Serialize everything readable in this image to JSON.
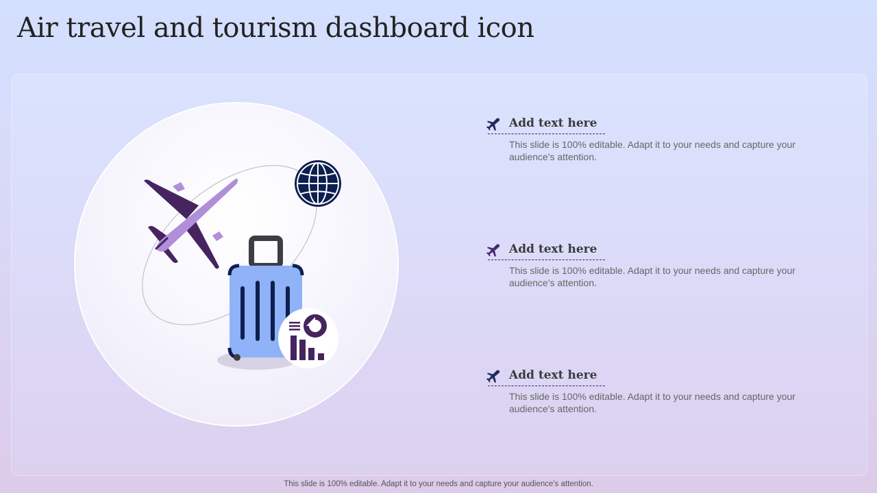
{
  "page": {
    "title": "Air travel and tourism dashboard icon"
  },
  "illustration": {
    "icons": [
      "airplane-icon",
      "globe-icon",
      "suitcase-icon",
      "dashboard-chart-icon"
    ]
  },
  "items": [
    {
      "title": "Add text here",
      "description": "This slide is 100% editable. Adapt it to your needs and capture your audience's attention.",
      "icon": "airplane-icon",
      "icon_color": "#1e2a5c"
    },
    {
      "title": "Add text here",
      "description": "This slide is 100% editable. Adapt it to your needs and capture your audience's attention.",
      "icon": "airplane-icon",
      "icon_color": "#4b2a6e"
    },
    {
      "title": "Add text here",
      "description": "This slide is 100% editable. Adapt it to your needs and capture your audience's attention.",
      "icon": "airplane-icon",
      "icon_color": "#1e2a5c"
    }
  ],
  "footer": {
    "text": "This slide is 100% editable. Adapt it to your needs and capture your audience's attention."
  },
  "colors": {
    "plane_body": "#b18fd8",
    "plane_wings": "#45245f",
    "globe": "#0d1f4f",
    "suitcase": "#8fb2f8",
    "chart": "#45245f"
  }
}
